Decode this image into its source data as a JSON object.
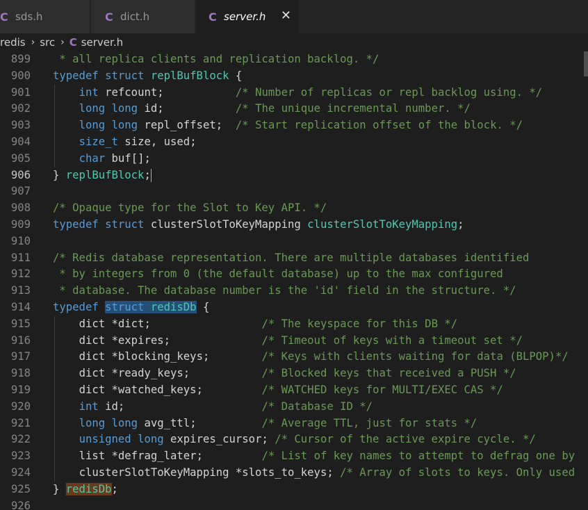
{
  "tabs": [
    {
      "icon": "C",
      "label": "sds.h",
      "active": false
    },
    {
      "icon": "C",
      "label": "dict.h",
      "active": false
    },
    {
      "icon": "C",
      "label": "server.h",
      "active": true,
      "close": "✕"
    }
  ],
  "breadcrumb": {
    "items": [
      "redis",
      "src",
      "server.h"
    ],
    "separator": "›",
    "file_icon": "C"
  },
  "editor": {
    "lines": [
      {
        "n": "899",
        "code": " * all replica clients and replication backlog. */"
      },
      {
        "n": "900",
        "code": "typedef struct replBufBlock {"
      },
      {
        "n": "901",
        "code": "    int refcount;           /* Number of replicas or repl backlog using. */"
      },
      {
        "n": "902",
        "code": "    long long id;           /* The unique incremental number. */"
      },
      {
        "n": "903",
        "code": "    long long repl_offset;  /* Start replication offset of the block. */"
      },
      {
        "n": "904",
        "code": "    size_t size, used;"
      },
      {
        "n": "905",
        "code": "    char buf[];"
      },
      {
        "n": "906",
        "code": "} replBufBlock;"
      },
      {
        "n": "907",
        "code": ""
      },
      {
        "n": "908",
        "code": "/* Opaque type for the Slot to Key API. */"
      },
      {
        "n": "909",
        "code": "typedef struct clusterSlotToKeyMapping clusterSlotToKeyMapping;"
      },
      {
        "n": "910",
        "code": ""
      },
      {
        "n": "911",
        "code": "/* Redis database representation. There are multiple databases identified"
      },
      {
        "n": "912",
        "code": " * by integers from 0 (the default database) up to the max configured"
      },
      {
        "n": "913",
        "code": " * database. The database number is the 'id' field in the structure. */"
      },
      {
        "n": "914",
        "code": "typedef struct redisDb {"
      },
      {
        "n": "915",
        "code": "    dict *dict;                 /* The keyspace for this DB */"
      },
      {
        "n": "916",
        "code": "    dict *expires;              /* Timeout of keys with a timeout set */"
      },
      {
        "n": "917",
        "code": "    dict *blocking_keys;        /* Keys with clients waiting for data (BLPOP)*/"
      },
      {
        "n": "918",
        "code": "    dict *ready_keys;           /* Blocked keys that received a PUSH */"
      },
      {
        "n": "919",
        "code": "    dict *watched_keys;         /* WATCHED keys for MULTI/EXEC CAS */"
      },
      {
        "n": "920",
        "code": "    int id;                     /* Database ID */"
      },
      {
        "n": "921",
        "code": "    long long avg_ttl;          /* Average TTL, just for stats */"
      },
      {
        "n": "922",
        "code": "    unsigned long expires_cursor; /* Cursor of the active expire cycle. */"
      },
      {
        "n": "923",
        "code": "    list *defrag_later;         /* List of key names to attempt to defrag one by"
      },
      {
        "n": "924",
        "code": "    clusterSlotToKeyMapping *slots_to_keys; /* Array of slots to keys. Only used"
      },
      {
        "n": "925",
        "code": "} redisDb;"
      },
      {
        "n": "926",
        "code": ""
      }
    ],
    "current_line": "906"
  },
  "colors": {
    "keyword": "#569cd6",
    "type": "#4ec9b0",
    "comment": "#6a9955",
    "c_icon": "#a074c4"
  }
}
